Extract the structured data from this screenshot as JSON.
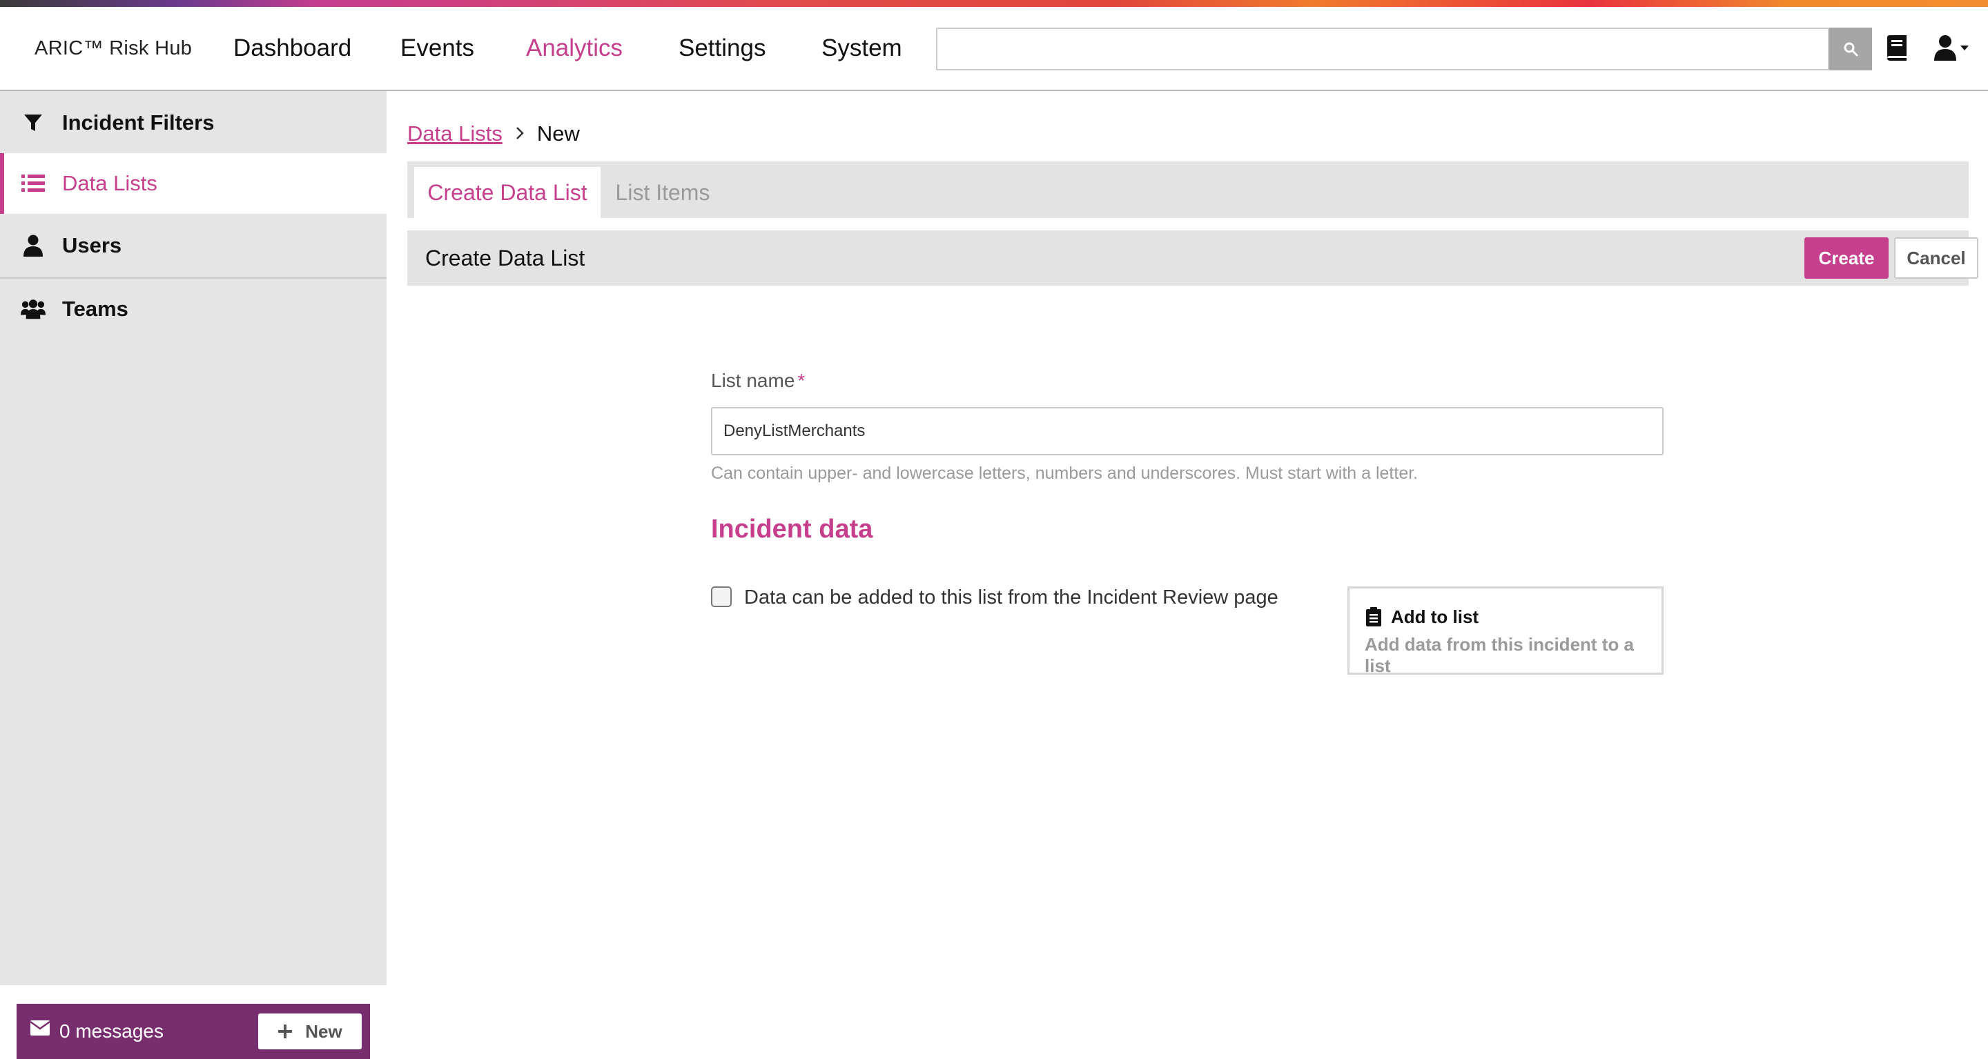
{
  "app": {
    "brand": "ARIC™ Risk Hub"
  },
  "nav": {
    "items": [
      {
        "label": "Dashboard"
      },
      {
        "label": "Events"
      },
      {
        "label": "Analytics"
      },
      {
        "label": "Settings"
      },
      {
        "label": "System"
      }
    ],
    "active": "Analytics"
  },
  "search": {
    "placeholder": "",
    "value": ""
  },
  "icons": {
    "search": "search-icon",
    "docs": "book-icon",
    "user_menu": "user-icon"
  },
  "sidebar": {
    "items": [
      {
        "label": "Incident Filters",
        "icon": "filter-icon"
      },
      {
        "label": "Data Lists",
        "icon": "list-icon"
      },
      {
        "label": "Users",
        "icon": "user-icon"
      },
      {
        "label": "Teams",
        "icon": "users-icon"
      }
    ],
    "active": "Data Lists",
    "messages": {
      "count_text": "0 messages",
      "new_label": "New"
    }
  },
  "breadcrumb": {
    "parent": "Data Lists",
    "current": "New"
  },
  "tabs": [
    {
      "label": "Create Data List",
      "active": true
    },
    {
      "label": "List Items",
      "active": false
    }
  ],
  "panel": {
    "title": "Create Data List",
    "create_label": "Create",
    "cancel_label": "Cancel"
  },
  "form": {
    "list_name_label": "List name",
    "required_mark": "*",
    "list_name_value": "DenyListMerchants",
    "list_name_hint": "Can contain upper- and lowercase letters, numbers and underscores. Must start with a letter.",
    "incident_section_title": "Incident data",
    "incident_checkbox_label": "Data can be added to this list from the Incident Review page",
    "incident_checkbox_checked": false
  },
  "preview": {
    "title": "Add to list",
    "subtitle": "Add data from this incident to a list"
  },
  "colors": {
    "accent": "#c63f8c",
    "messages_bg": "#772e6e",
    "sidebar_bg": "#e5e5e5"
  }
}
